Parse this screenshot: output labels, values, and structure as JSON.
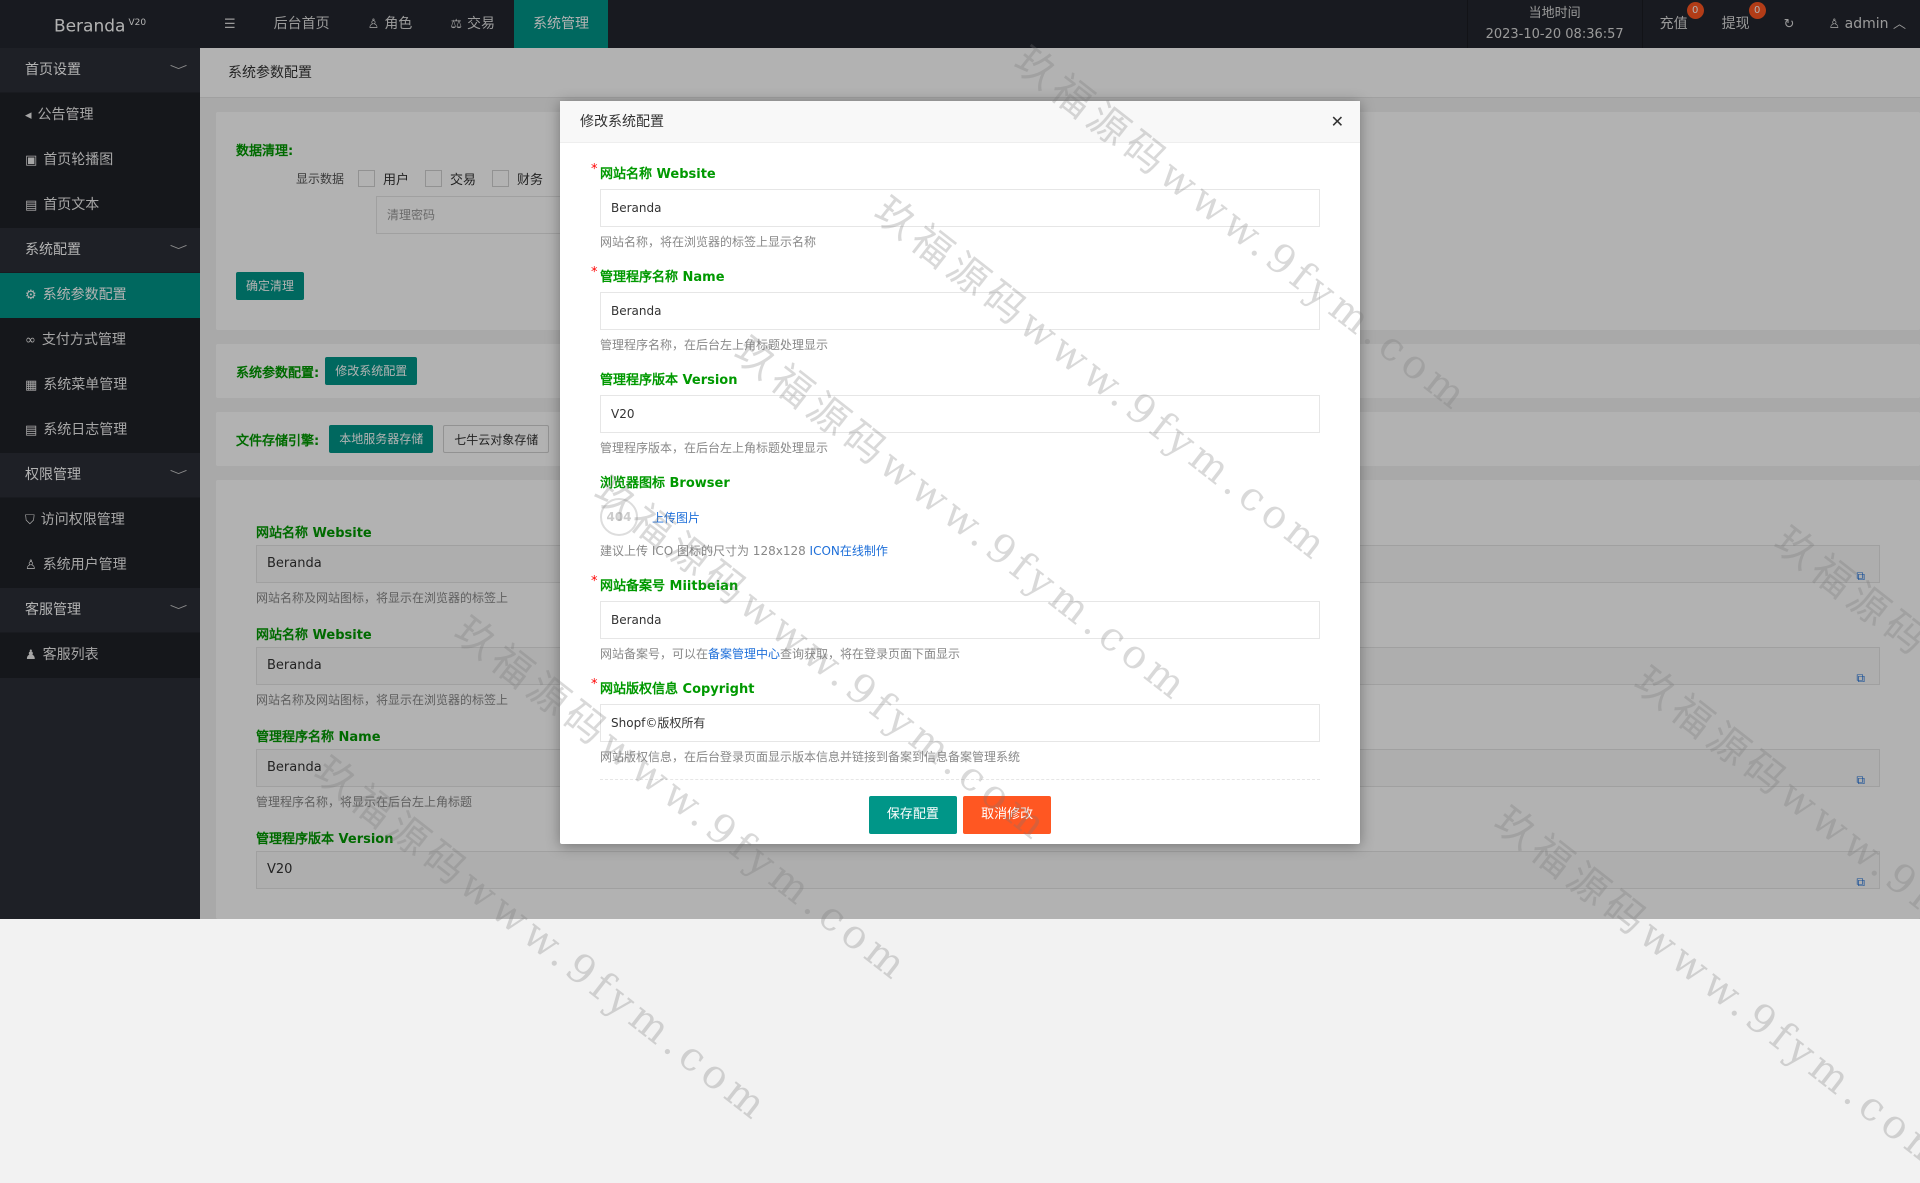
{
  "topbar": {
    "logo": "Beranda",
    "logo_version": "V20",
    "menu_toggle_icon": "hamburger-icon",
    "nav": [
      {
        "label": "后台首页",
        "icon": ""
      },
      {
        "label": "角色",
        "icon": "user-icon"
      },
      {
        "label": "交易",
        "icon": "scale-icon"
      },
      {
        "label": "系统管理",
        "icon": "",
        "active": true
      }
    ],
    "time_label": "当地时间",
    "time_value": "2023-10-20 08:36:57",
    "recharge_label": "充值",
    "recharge_badge": "0",
    "withdraw_label": "提现",
    "withdraw_badge": "0",
    "user_label": "admin"
  },
  "sidebar": {
    "groups": [
      {
        "label": "首页设置",
        "items": [
          "公告管理",
          "首页轮播图",
          "首页文本"
        ]
      },
      {
        "label": "系统配置",
        "items": [
          "系统参数配置",
          "支付方式管理",
          "系统菜单管理",
          "系统日志管理"
        ]
      },
      {
        "label": "权限管理",
        "items": [
          "访问权限管理",
          "系统用户管理"
        ]
      },
      {
        "label": "客服管理",
        "items": [
          "客服列表"
        ]
      }
    ]
  },
  "main": {
    "breadcrumb": "系统参数配置",
    "clean": {
      "title": "数据清理:",
      "show_label": "显示数据",
      "options": [
        "用户",
        "交易",
        "财务"
      ],
      "password_placeholder": "清理密码",
      "confirm_button": "确定清理"
    },
    "params_label": "系统参数配置:",
    "params_button": "修改系统配置",
    "storage_label": "文件存储引擎:",
    "storage_options": [
      "本地服务器存储",
      "七牛云对象存储"
    ],
    "fields": [
      {
        "label": "网站名称 Website",
        "value": "Beranda",
        "hint": "网站名称及网站图标，将显示在浏览器的标签上"
      },
      {
        "label": "网站名称 Website",
        "value": "Beranda",
        "hint": "网站名称及网站图标，将显示在浏览器的标签上"
      },
      {
        "label": "管理程序名称 Name",
        "value": "Beranda",
        "hint": "管理程序名称，将显示在后台左上角标题"
      },
      {
        "label": "管理程序版本 Version",
        "value": "V20",
        "hint": ""
      }
    ]
  },
  "modal": {
    "title": "修改系统配置",
    "fields": [
      {
        "label": "网站名称 Website",
        "required": true,
        "value": "Beranda",
        "hint": "网站名称，将在浏览器的标签上显示名称"
      },
      {
        "label": "管理程序名称 Name",
        "required": true,
        "value": "Beranda",
        "hint": "管理程序名称，在后台左上角标题处理显示"
      },
      {
        "label": "管理程序版本 Version",
        "required": false,
        "value": "V20",
        "hint": "管理程序版本，在后台左上角标题处理显示"
      }
    ],
    "browser_icon": {
      "label": "浏览器图标 Browser",
      "image_text": "404",
      "upload_label": "上传图片",
      "hint": "建议上传 ICO 图标的尺寸为 128x128",
      "hint_link": "ICON在线制作"
    },
    "beian": {
      "label": "网站备案号 Miitbeian",
      "value": "Beranda",
      "hint_pre": "网站备案号，可以在",
      "hint_link": "备案管理中心",
      "hint_post": "查询获取，将在登录页面下面显示"
    },
    "copyright": {
      "label": "网站版权信息 Copyright",
      "value": "Shopf©版权所有",
      "hint": "网站版权信息，在后台登录页面显示版本信息并链接到备案到信息备案管理系统"
    },
    "save_button": "保存配置",
    "cancel_button": "取消修改"
  },
  "watermark": "玖福源码www.9fym.com"
}
